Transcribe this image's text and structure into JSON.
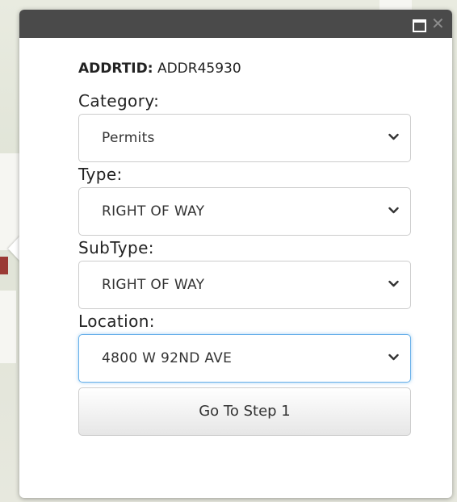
{
  "popup": {
    "id_label": "ADDRTID:",
    "id_value": "ADDR45930",
    "fields": [
      {
        "label": "Category:",
        "value": "Permits"
      },
      {
        "label": "Type:",
        "value": "RIGHT OF WAY"
      },
      {
        "label": "SubType:",
        "value": "RIGHT OF WAY"
      },
      {
        "label": "Location:",
        "value": "4800 W 92ND AVE"
      }
    ],
    "submit_label": "Go To Step 1",
    "icons": {
      "maximize": "maximize-icon",
      "close": "close-icon",
      "dropdown": "chevron-down-icon"
    },
    "colors": {
      "titlebar": "#4a4a4a",
      "focus_border": "#66afe9"
    }
  }
}
